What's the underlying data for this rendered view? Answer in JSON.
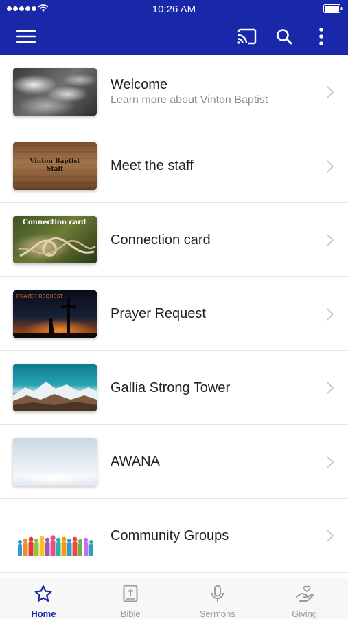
{
  "status_bar": {
    "time": "10:26 AM"
  },
  "app_bar": {
    "menu_icon": "hamburger-icon",
    "cast_icon": "cast-icon",
    "search_icon": "search-icon",
    "more_icon": "more-vert-icon",
    "color": "#1928a8"
  },
  "list": {
    "items": [
      {
        "title": "Welcome",
        "subtitle": "Learn more about Vinton Baptist"
      },
      {
        "title": "Meet the staff",
        "thumb_text": [
          "Vinton Baptist",
          "Staff"
        ]
      },
      {
        "title": "Connection card",
        "thumb_text": "Connection card"
      },
      {
        "title": "Prayer Request",
        "thumb_text": "PRAYER REQUEST"
      },
      {
        "title": "Gallia Strong Tower"
      },
      {
        "title": "AWANA"
      },
      {
        "title": "Community Groups"
      }
    ]
  },
  "bottom_nav": {
    "tabs": [
      {
        "label": "Home",
        "icon": "star-icon",
        "active": true
      },
      {
        "label": "Bible",
        "icon": "bible-icon",
        "active": false
      },
      {
        "label": "Sermons",
        "icon": "microphone-icon",
        "active": false
      },
      {
        "label": "Giving",
        "icon": "giving-hand-icon",
        "active": false
      }
    ],
    "active_color": "#1928a8"
  }
}
